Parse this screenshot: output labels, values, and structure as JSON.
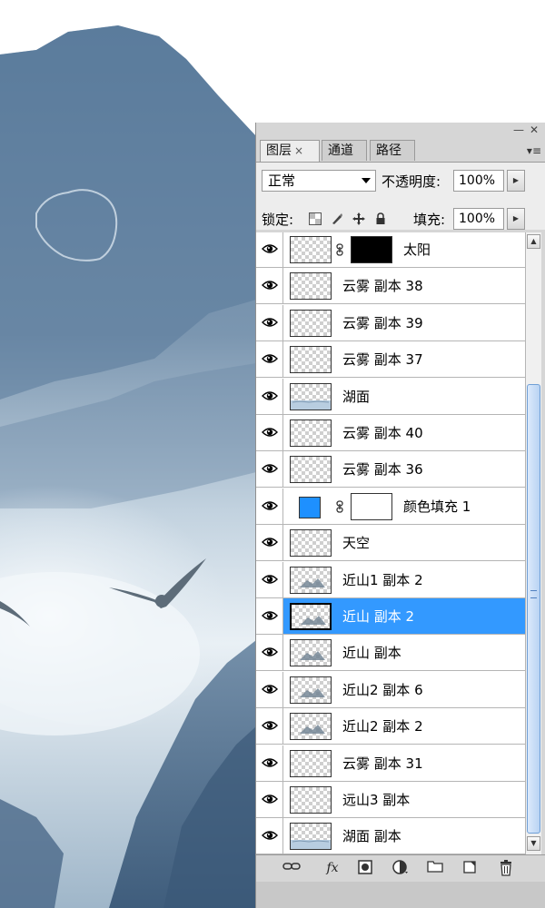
{
  "panel": {
    "minimize_glyph": "—",
    "close_glyph": "✕",
    "menu_glyph": "▾≡",
    "tabs": [
      {
        "label": "图层",
        "close": "×",
        "active": true
      },
      {
        "label": "通道",
        "active": false
      },
      {
        "label": "路径",
        "active": false
      }
    ],
    "blend_mode": "正常",
    "opacity_label": "不透明度:",
    "opacity_value": "100%",
    "lock_label": "锁定:",
    "fill_label": "填充:",
    "fill_value": "100%",
    "stepper_glyph": "▶",
    "lock_icons": [
      "lock-transparent-icon",
      "lock-image-brush-icon",
      "lock-position-move-icon",
      "lock-all-padlock-icon"
    ]
  },
  "layers": [
    {
      "name": "太阳",
      "visible": true,
      "thumb": "transparent",
      "mask": "black"
    },
    {
      "name": "云雾 副本 38",
      "visible": true,
      "thumb": "transparent"
    },
    {
      "name": "云雾 副本 39",
      "visible": true,
      "thumb": "transparent"
    },
    {
      "name": "云雾 副本 37",
      "visible": true,
      "thumb": "transparent"
    },
    {
      "name": "湖面",
      "visible": true,
      "thumb": "lake"
    },
    {
      "name": "云雾 副本 40",
      "visible": true,
      "thumb": "transparent"
    },
    {
      "name": "云雾 副本 36",
      "visible": true,
      "thumb": "transparent"
    },
    {
      "name": "颜色填充 1",
      "visible": true,
      "thumb": "fill",
      "fill_color": "#1e90ff",
      "mask": "white"
    },
    {
      "name": "天空",
      "visible": true,
      "thumb": "transparent"
    },
    {
      "name": "近山1 副本 2",
      "visible": true,
      "thumb": "mountain"
    },
    {
      "name": "近山 副本 2",
      "visible": true,
      "thumb": "mountain",
      "selected": true
    },
    {
      "name": "近山 副本",
      "visible": true,
      "thumb": "mountain"
    },
    {
      "name": "近山2 副本 6",
      "visible": true,
      "thumb": "mountain"
    },
    {
      "name": "近山2 副本 2",
      "visible": true,
      "thumb": "mountain"
    },
    {
      "name": "云雾 副本 31",
      "visible": true,
      "thumb": "transparent"
    },
    {
      "name": "远山3 副本",
      "visible": true,
      "thumb": "transparent"
    },
    {
      "name": "湖面 副本",
      "visible": true,
      "thumb": "lake"
    }
  ],
  "footer": {
    "icons": [
      "link-layers-icon",
      "layer-style-fx-icon",
      "add-mask-icon",
      "adjustment-layer-icon",
      "new-group-folder-icon",
      "new-layer-icon",
      "delete-trash-icon"
    ],
    "fx_label": "fx"
  },
  "colors": {
    "selection": "#3399ff",
    "panel_bg": "#d6d6d6",
    "sky_blue": "#5f7f9f"
  }
}
